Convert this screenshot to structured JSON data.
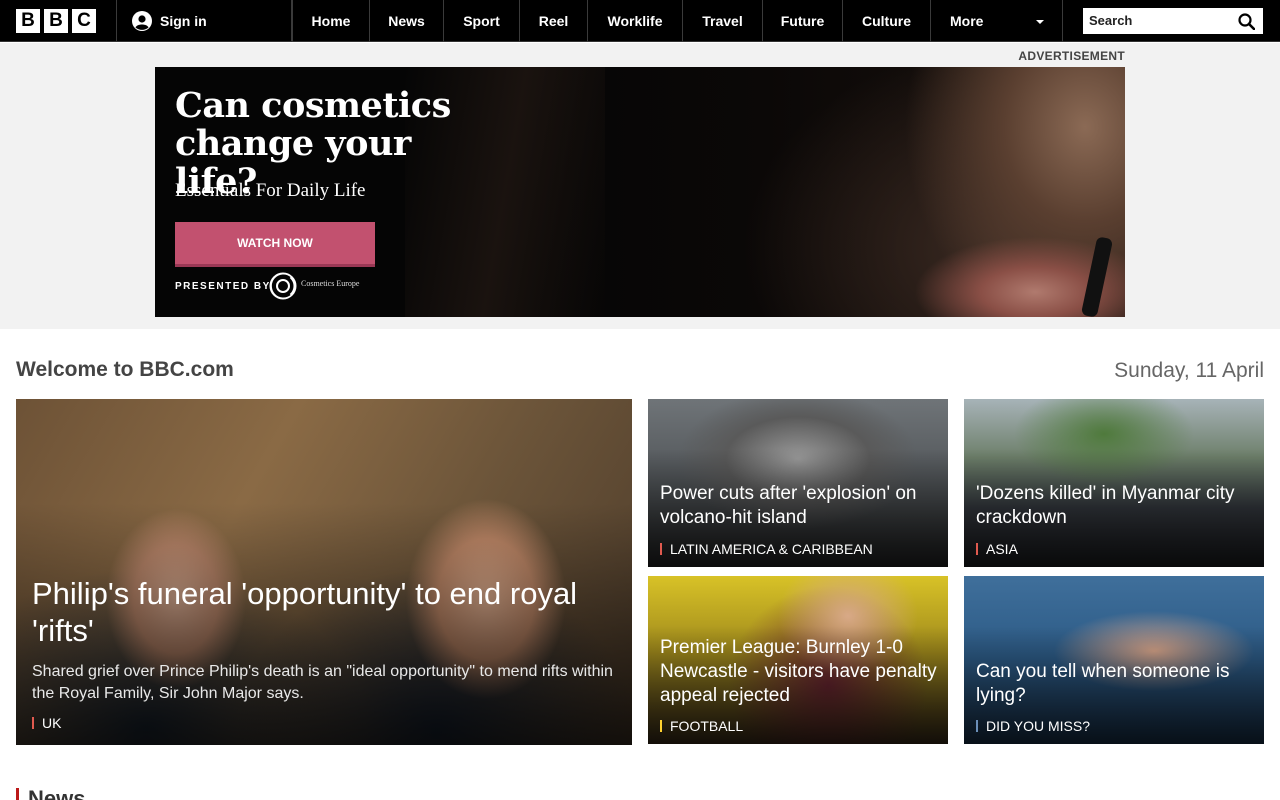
{
  "header": {
    "logo_letters": [
      "B",
      "B",
      "C"
    ],
    "signin_label": "Sign in",
    "nav": [
      "Home",
      "News",
      "Sport",
      "Reel",
      "Worklife",
      "Travel",
      "Future",
      "Culture"
    ],
    "more_label": "More",
    "search_placeholder": "Search"
  },
  "ad": {
    "label": "ADVERTISEMENT",
    "headline": "Can cosmetics change your life?",
    "subline": "Essentials For Daily Life",
    "button_label": "WATCH NOW",
    "presented_by": "PRESENTED BY",
    "sponsor_name": "Cosmetics Europe",
    "button_color": "#c2516f"
  },
  "welcome": {
    "title": "Welcome to BBC.com",
    "date": "Sunday, 11 April"
  },
  "stories": {
    "main": {
      "title": "Philip's funeral 'opportunity' to end royal 'rifts'",
      "summary": "Shared grief over Prince Philip's death is an \"ideal opportunity\" to mend rifts within the Royal Family, Sir John Major says.",
      "tag": "UK",
      "tag_color": "#e05a4f"
    },
    "items": [
      {
        "title": "Power cuts after 'explosion' on volcano-hit island",
        "tag": "LATIN AMERICA & CARIBBEAN",
        "tag_color": "#e05a4f"
      },
      {
        "title": "'Dozens killed' in Myanmar city crackdown",
        "tag": "ASIA",
        "tag_color": "#e05a4f"
      },
      {
        "title": "Premier League: Burnley 1-0 Newcastle - visitors have penalty appeal rejected",
        "tag": "FOOTBALL",
        "tag_color": "#ffd230"
      },
      {
        "title": "Can you tell when someone is lying?",
        "tag": "DID YOU MISS?",
        "tag_color": "#6b8fb8"
      }
    ]
  },
  "sections": {
    "news_heading": "News",
    "news_color": "#bb1919"
  }
}
